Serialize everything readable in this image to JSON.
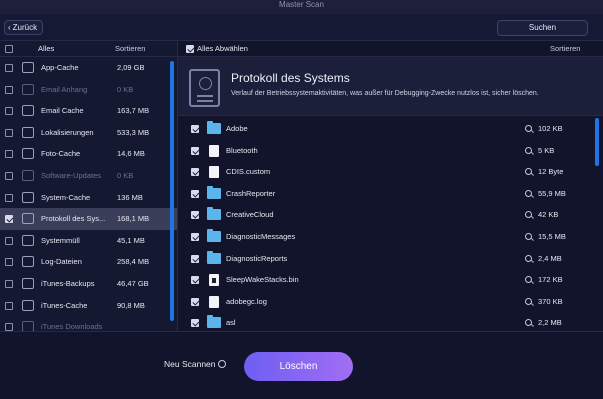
{
  "window": {
    "title": "Master Scan"
  },
  "toolbar": {
    "back_label": "Zurück",
    "search_label": "Suchen"
  },
  "left_panel": {
    "header_all": "Alles",
    "header_sort": "Sortieren",
    "categories": [
      {
        "name": "App-Cache",
        "size": "2,09 GB",
        "checked": false,
        "dim": false,
        "selected": false
      },
      {
        "name": "Email Anhang",
        "size": "0 KB",
        "checked": false,
        "dim": true,
        "selected": false
      },
      {
        "name": "Email Cache",
        "size": "163,7 MB",
        "checked": false,
        "dim": false,
        "selected": false
      },
      {
        "name": "Lokalisierungen",
        "size": "533,3 MB",
        "checked": false,
        "dim": false,
        "selected": false
      },
      {
        "name": "Foto-Cache",
        "size": "14,6 MB",
        "checked": false,
        "dim": false,
        "selected": false
      },
      {
        "name": "Software-Updates",
        "size": "0 KB",
        "checked": false,
        "dim": true,
        "selected": false
      },
      {
        "name": "System-Cache",
        "size": "136 MB",
        "checked": false,
        "dim": false,
        "selected": false
      },
      {
        "name": "Protokoll des Sys...",
        "size": "168,1 MB",
        "checked": true,
        "dim": false,
        "selected": true
      },
      {
        "name": "Systemmüll",
        "size": "45,1 MB",
        "checked": false,
        "dim": false,
        "selected": false
      },
      {
        "name": "Log-Dateien",
        "size": "258,4 MB",
        "checked": false,
        "dim": false,
        "selected": false
      },
      {
        "name": "iTunes-Backups",
        "size": "46,47 GB",
        "checked": false,
        "dim": false,
        "selected": false
      },
      {
        "name": "iTunes-Cache",
        "size": "90,8 MB",
        "checked": false,
        "dim": false,
        "selected": false
      },
      {
        "name": "iTunes Downloads",
        "size": "",
        "checked": false,
        "dim": true,
        "selected": false
      }
    ]
  },
  "right_panel": {
    "header_deselect": "Alles Abwählen",
    "header_sort": "Sortieren",
    "info": {
      "title": "Protokoll des Systems",
      "description": "Verlauf der Betriebssystemaktivitäten, was außer für Debugging-Zwecke nutzlos ist, sicher löschen."
    },
    "files": [
      {
        "name": "Adobe",
        "size": "102 KB",
        "icon": "folder-icon"
      },
      {
        "name": "Bluetooth",
        "size": "5 KB",
        "icon": "document-icon"
      },
      {
        "name": "CDIS.custom",
        "size": "12 Byte",
        "icon": "document-icon"
      },
      {
        "name": "CrashReporter",
        "size": "55,9 MB",
        "icon": "folder-icon"
      },
      {
        "name": "CreativeCloud",
        "size": "42 KB",
        "icon": "folder-icon"
      },
      {
        "name": "DiagnosticMessages",
        "size": "15,5 MB",
        "icon": "folder-icon"
      },
      {
        "name": "DiagnosticReports",
        "size": "2,4 MB",
        "icon": "folder-icon"
      },
      {
        "name": "SleepWakeStacks.bin",
        "size": "172 KB",
        "icon": "binary-file-icon"
      },
      {
        "name": "adobegc.log",
        "size": "370 KB",
        "icon": "document-icon"
      },
      {
        "name": "asl",
        "size": "2,2 MB",
        "icon": "folder-icon"
      }
    ]
  },
  "footer": {
    "rescan_label": "Neu Scannen",
    "delete_label": "Löschen"
  },
  "colors": {
    "accent_start": "#6d5ff2",
    "accent_end": "#a26df4",
    "folder": "#5bb5ea",
    "scrollbar": "#1f74e6"
  }
}
